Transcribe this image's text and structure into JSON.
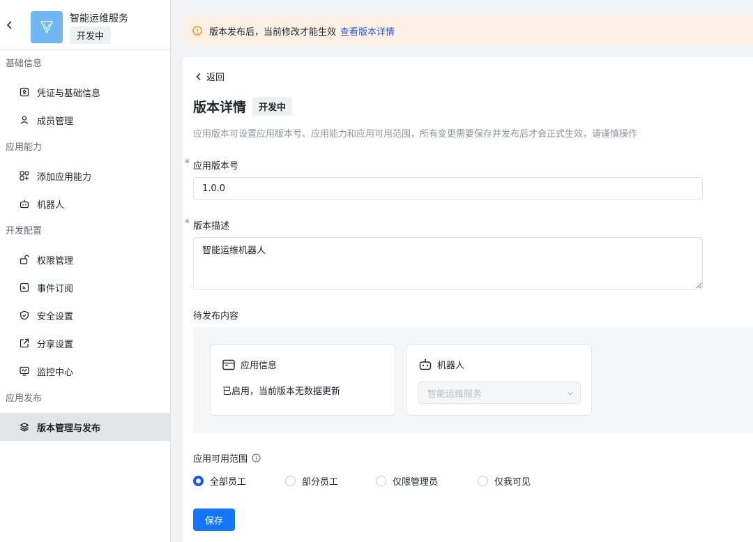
{
  "sidebar": {
    "app_name": "智能运维服务",
    "app_status": "开发中",
    "groups": [
      {
        "title": "基础信息",
        "items": [
          {
            "label": "凭证与基础信息",
            "icon": "credential-icon"
          },
          {
            "label": "成员管理",
            "icon": "member-icon"
          }
        ]
      },
      {
        "title": "应用能力",
        "items": [
          {
            "label": "添加应用能力",
            "icon": "add-capability-icon"
          },
          {
            "label": "机器人",
            "icon": "robot-icon"
          }
        ]
      },
      {
        "title": "开发配置",
        "items": [
          {
            "label": "权限管理",
            "icon": "permission-icon"
          },
          {
            "label": "事件订阅",
            "icon": "event-icon"
          },
          {
            "label": "安全设置",
            "icon": "shield-icon"
          },
          {
            "label": "分享设置",
            "icon": "share-icon"
          },
          {
            "label": "监控中心",
            "icon": "monitor-icon"
          }
        ]
      },
      {
        "title": "应用发布",
        "items": [
          {
            "label": "版本管理与发布",
            "icon": "layers-icon",
            "active": true
          }
        ]
      }
    ]
  },
  "banner": {
    "text": "版本发布后，当前修改才能生效",
    "link": "查看版本详情"
  },
  "main": {
    "back_label": "返回",
    "title": "版本详情",
    "title_tag": "开发中",
    "description": "应用版本可设置应用版本号、应用能力和应用可用范围，所有变更需要保存并发布后才会正式生效，请谨慎操作",
    "version_label": "应用版本号",
    "version_value": "1.0.0",
    "desc_label": "版本描述",
    "desc_value": "智能运维机器人",
    "pending_label": "待发布内容",
    "pending": {
      "app_info_title": "应用信息",
      "app_info_text": "已启用，当前版本无数据更新",
      "robot_title": "机器人",
      "robot_select": "智能运维服务"
    },
    "scope_label": "应用可用范围",
    "scope_options": [
      "全部员工",
      "部分员工",
      "仅限管理员",
      "仅我可见"
    ],
    "scope_selected": "全部员工",
    "save_label": "保存"
  },
  "colors": {
    "primary": "#1476ff",
    "radio_checked": "#1456f0",
    "link": "#245bdb",
    "banner_bg": "#fdf0e6",
    "warn": "#ff8800",
    "required": "#f54a45"
  }
}
